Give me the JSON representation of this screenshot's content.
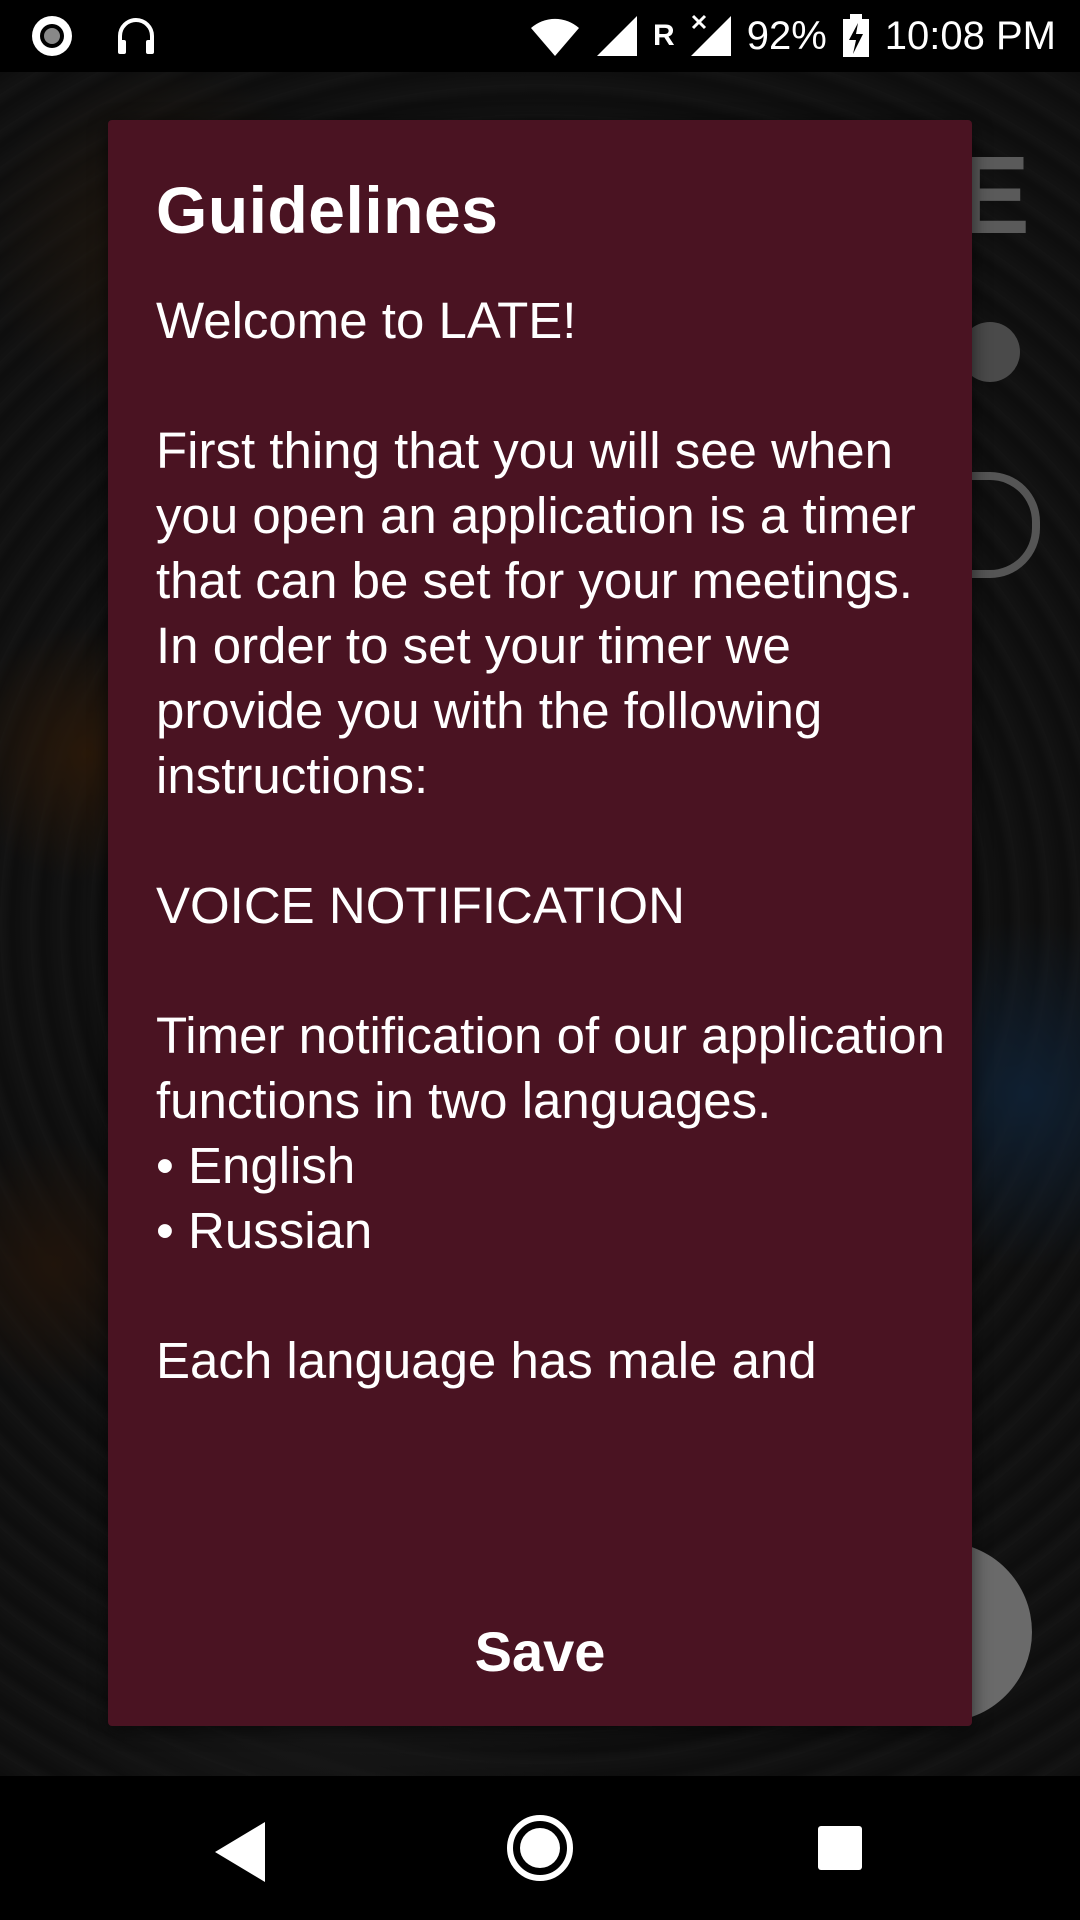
{
  "status_bar": {
    "battery": "92%",
    "time": "10:08 PM",
    "roaming": "R",
    "icons": [
      "record-icon",
      "headphones-icon",
      "wifi-icon",
      "signal-icon",
      "no-signal-icon",
      "battery-charging-icon"
    ]
  },
  "dialog": {
    "title": "Guidelines",
    "body": {
      "welcome": "Welcome to LATE!",
      "intro_1": "First thing that you will see when you open an application is a timer that can be set for your meetings.",
      "intro_2": "In order to set your timer we provide you with the following instructions:",
      "section_heading": "VOICE NOTIFICATION",
      "section_text": "Timer notification of our application functions in two languages.",
      "languages": [
        "• English",
        "• Russian"
      ],
      "partial_line": "Each language has male and"
    },
    "save_label": "Save"
  },
  "background": {
    "title_fragment": "E"
  },
  "nav_bar": {
    "icons": [
      "back-icon",
      "home-icon",
      "recents-icon"
    ]
  }
}
